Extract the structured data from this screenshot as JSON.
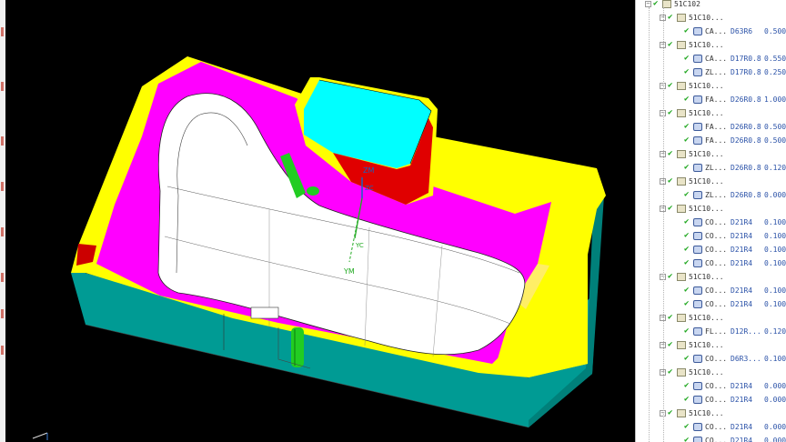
{
  "colors": {
    "cavity_white": "#ffffff",
    "magenta_walls": "#ff00ff",
    "yellow_faces": "#ffff00",
    "teal_base": "#009b94",
    "cyan_top": "#00ffff",
    "red_face": "#e00000",
    "green_marks": "#22cc22",
    "check_green": "#1aa51a"
  },
  "viewport": {
    "axis_labels": {
      "zm": "ZM",
      "yc": "YC",
      "ym": "YM",
      "zc": "ZC"
    }
  },
  "tree": {
    "rows": [
      {
        "level": 0,
        "expander": "minus",
        "kind": "group",
        "name": "51C102",
        "tool": "",
        "stock": ""
      },
      {
        "level": 1,
        "expander": "minus",
        "kind": "group",
        "name": "51C10...",
        "tool": "",
        "stock": ""
      },
      {
        "level": 2,
        "expander": "none",
        "kind": "op",
        "name": "CA...",
        "tool": "D63R6",
        "stock": "0.500"
      },
      {
        "level": 1,
        "expander": "minus",
        "kind": "group",
        "name": "51C10...",
        "tool": "",
        "stock": ""
      },
      {
        "level": 2,
        "expander": "none",
        "kind": "op",
        "name": "CA...",
        "tool": "D17R0.8",
        "stock": "0.550"
      },
      {
        "level": 2,
        "expander": "none",
        "kind": "op",
        "name": "ZL...",
        "tool": "D17R0.8",
        "stock": "0.250"
      },
      {
        "level": 1,
        "expander": "minus",
        "kind": "group",
        "name": "51C10...",
        "tool": "",
        "stock": ""
      },
      {
        "level": 2,
        "expander": "none",
        "kind": "op",
        "name": "FA...",
        "tool": "D26R0.8",
        "stock": "1.000"
      },
      {
        "level": 1,
        "expander": "minus",
        "kind": "group",
        "name": "51C10...",
        "tool": "",
        "stock": ""
      },
      {
        "level": 2,
        "expander": "none",
        "kind": "op",
        "name": "FA...",
        "tool": "D26R0.8",
        "stock": "0.500"
      },
      {
        "level": 2,
        "expander": "none",
        "kind": "op",
        "name": "FA...",
        "tool": "D26R0.8",
        "stock": "0.500"
      },
      {
        "level": 1,
        "expander": "minus",
        "kind": "group",
        "name": "51C10...",
        "tool": "",
        "stock": ""
      },
      {
        "level": 2,
        "expander": "none",
        "kind": "op",
        "name": "ZL...",
        "tool": "D26R0.8",
        "stock": "0.120"
      },
      {
        "level": 1,
        "expander": "minus",
        "kind": "group",
        "name": "51C10...",
        "tool": "",
        "stock": ""
      },
      {
        "level": 2,
        "expander": "none",
        "kind": "op",
        "name": "ZL...",
        "tool": "D26R0.8",
        "stock": "0.000"
      },
      {
        "level": 1,
        "expander": "minus",
        "kind": "group",
        "name": "51C10...",
        "tool": "",
        "stock": ""
      },
      {
        "level": 2,
        "expander": "none",
        "kind": "op",
        "name": "CO...",
        "tool": "D21R4",
        "stock": "0.100"
      },
      {
        "level": 2,
        "expander": "none",
        "kind": "op",
        "name": "CO...",
        "tool": "D21R4",
        "stock": "0.100"
      },
      {
        "level": 2,
        "expander": "none",
        "kind": "op",
        "name": "CO...",
        "tool": "D21R4",
        "stock": "0.100"
      },
      {
        "level": 2,
        "expander": "none",
        "kind": "op",
        "name": "CO...",
        "tool": "D21R4",
        "stock": "0.100"
      },
      {
        "level": 1,
        "expander": "minus",
        "kind": "group",
        "name": "51C10...",
        "tool": "",
        "stock": ""
      },
      {
        "level": 2,
        "expander": "none",
        "kind": "op",
        "name": "CO...",
        "tool": "D21R4",
        "stock": "0.100"
      },
      {
        "level": 2,
        "expander": "none",
        "kind": "op",
        "name": "CO...",
        "tool": "D21R4",
        "stock": "0.100"
      },
      {
        "level": 1,
        "expander": "minus",
        "kind": "group",
        "name": "51C10...",
        "tool": "",
        "stock": ""
      },
      {
        "level": 2,
        "expander": "none",
        "kind": "op",
        "name": "FL...",
        "tool": "D12R...",
        "stock": "0.120"
      },
      {
        "level": 1,
        "expander": "minus",
        "kind": "group",
        "name": "51C10...",
        "tool": "",
        "stock": ""
      },
      {
        "level": 2,
        "expander": "none",
        "kind": "op",
        "name": "CO...",
        "tool": "D6R3...",
        "stock": "0.100"
      },
      {
        "level": 1,
        "expander": "minus",
        "kind": "group",
        "name": "51C10...",
        "tool": "",
        "stock": ""
      },
      {
        "level": 2,
        "expander": "none",
        "kind": "op",
        "name": "CO...",
        "tool": "D21R4",
        "stock": "0.000"
      },
      {
        "level": 2,
        "expander": "none",
        "kind": "op",
        "name": "CO...",
        "tool": "D21R4",
        "stock": "0.000"
      },
      {
        "level": 1,
        "expander": "minus",
        "kind": "group",
        "name": "51C10...",
        "tool": "",
        "stock": ""
      },
      {
        "level": 2,
        "expander": "none",
        "kind": "op",
        "name": "CO...",
        "tool": "D21R4",
        "stock": "0.000"
      },
      {
        "level": 2,
        "expander": "none",
        "kind": "op",
        "name": "CO...",
        "tool": "D21R4",
        "stock": "0.000"
      }
    ]
  }
}
